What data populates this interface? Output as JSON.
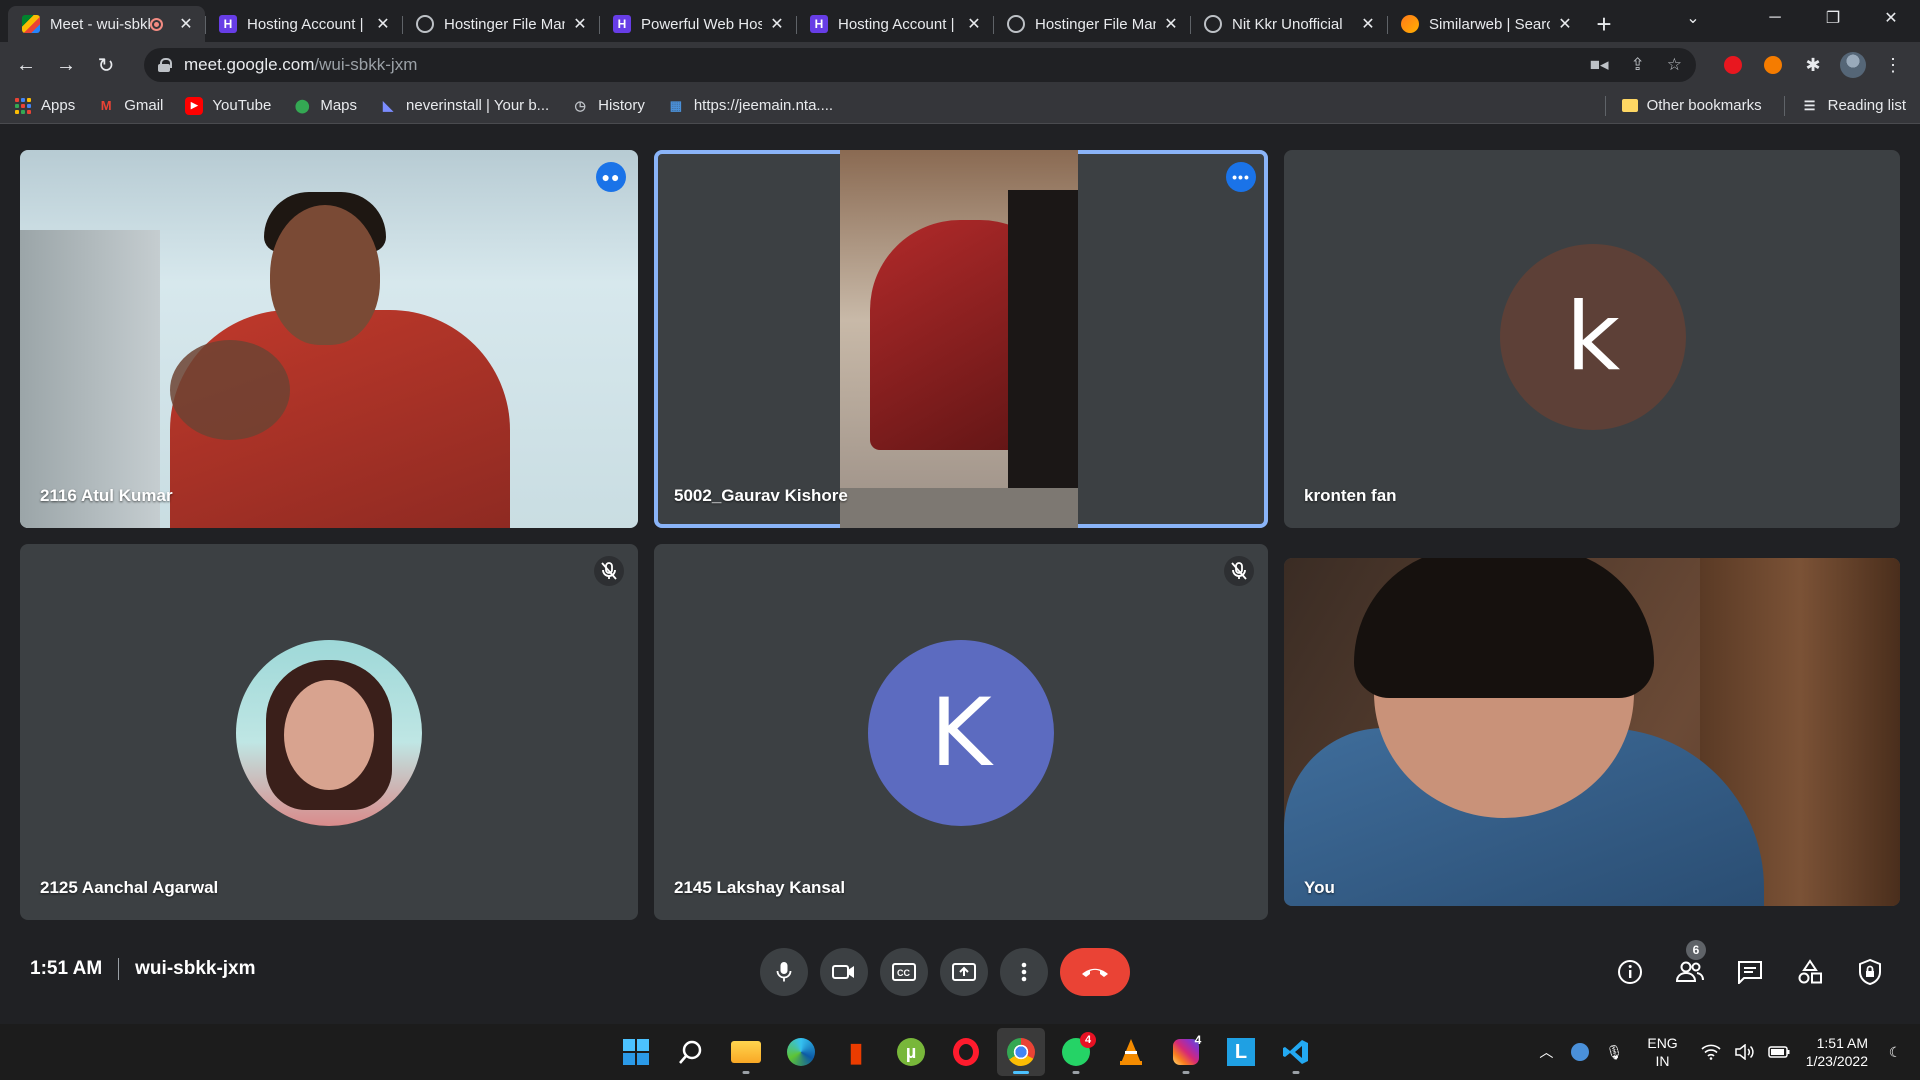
{
  "browser": {
    "tabs": [
      {
        "title": "Meet - wui-sbkk-jxm",
        "icon": "meet-icon",
        "recording": true,
        "active": true
      },
      {
        "title": "Hosting Account | Hostinger",
        "icon": "hostinger-icon"
      },
      {
        "title": "Hostinger File Manager",
        "icon": "globe-icon"
      },
      {
        "title": "Powerful Web Hosting",
        "icon": "hostinger-icon"
      },
      {
        "title": "Hosting Account | Hostinger",
        "icon": "hostinger-icon"
      },
      {
        "title": "Hostinger File Manager",
        "icon": "globe-icon"
      },
      {
        "title": "Nit Kkr Unofficial",
        "icon": "globe-icon"
      },
      {
        "title": "Similarweb | Search",
        "icon": "similarweb-icon"
      }
    ],
    "url_host": "meet.google.com",
    "url_path": "/wui-sbkk-jxm",
    "bookmarks": [
      {
        "label": "Apps",
        "icon": "apps-grid-icon"
      },
      {
        "label": "Gmail",
        "icon": "gmail-icon"
      },
      {
        "label": "YouTube",
        "icon": "youtube-icon"
      },
      {
        "label": "Maps",
        "icon": "maps-icon"
      },
      {
        "label": "neverinstall | Your b...",
        "icon": "neverinstall-icon"
      },
      {
        "label": "History",
        "icon": "history-icon"
      },
      {
        "label": "https://jeemain.nta....",
        "icon": "nta-icon"
      }
    ],
    "other_bookmarks": "Other bookmarks",
    "reading_list": "Reading list"
  },
  "meet": {
    "participants": [
      {
        "name": "2116 Atul Kumar",
        "kind": "video",
        "speaking": true
      },
      {
        "name": "5002_Gaurav Kishore",
        "kind": "video",
        "focused": true
      },
      {
        "name": "kronten fan",
        "kind": "avatar",
        "initial": "k",
        "color": "#5d4037"
      },
      {
        "name": "2125 Aanchal Agarwal",
        "kind": "photo",
        "muted": true
      },
      {
        "name": "2145 Lakshay Kansal",
        "kind": "avatar",
        "initial": "K",
        "color": "#5c6bc0",
        "muted": true
      },
      {
        "name": "You",
        "kind": "video"
      }
    ],
    "time": "1:51 AM",
    "meeting_code": "wui-sbkk-jxm",
    "people_count": "6",
    "end_call_color": "#ea4335"
  },
  "taskbar": {
    "apps": [
      "start-icon",
      "search-icon",
      "file-explorer-icon",
      "edge-icon",
      "office-icon",
      "utorrent-icon",
      "opera-icon",
      "chrome-icon",
      "whatsapp-icon",
      "vlc-icon",
      "instagram-icon",
      "lightshot-icon",
      "vscode-icon"
    ],
    "whatsapp_badge": "4",
    "instagram_badge": "4",
    "lang_top": "ENG",
    "lang_bottom": "IN",
    "clock_time": "1:51 AM",
    "clock_date": "1/23/2022"
  }
}
